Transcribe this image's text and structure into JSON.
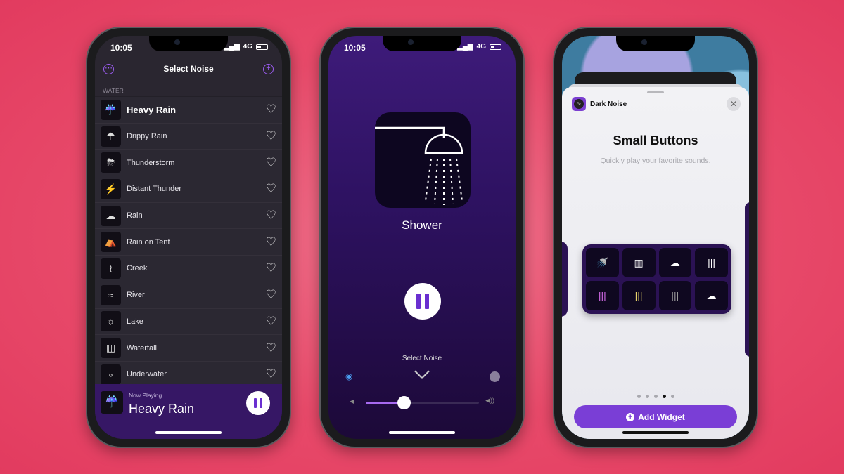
{
  "status": {
    "time": "10:05",
    "network": "4G"
  },
  "list_screen": {
    "title": "Select Noise",
    "section": "WATER",
    "items": [
      {
        "label": "Heavy Rain",
        "icon": "heavy-rain-icon",
        "glyph": "☔",
        "selected": true
      },
      {
        "label": "Drippy Rain",
        "icon": "drippy-rain-icon",
        "glyph": "☂"
      },
      {
        "label": "Thunderstorm",
        "icon": "thunderstorm-icon",
        "glyph": "⛈"
      },
      {
        "label": "Distant Thunder",
        "icon": "distant-thunder-icon",
        "glyph": "⚡"
      },
      {
        "label": "Rain",
        "icon": "rain-icon",
        "glyph": "☁"
      },
      {
        "label": "Rain on Tent",
        "icon": "tent-icon",
        "glyph": "⛺"
      },
      {
        "label": "Creek",
        "icon": "creek-icon",
        "glyph": "≀"
      },
      {
        "label": "River",
        "icon": "river-icon",
        "glyph": "≈"
      },
      {
        "label": "Lake",
        "icon": "lake-icon",
        "glyph": "☼"
      },
      {
        "label": "Waterfall",
        "icon": "waterfall-icon",
        "glyph": "▥"
      },
      {
        "label": "Underwater",
        "icon": "bubbles-icon",
        "glyph": "∘"
      }
    ],
    "heart": "♡",
    "now_playing": {
      "caption": "Now Playing",
      "title": "Heavy Rain"
    }
  },
  "player_screen": {
    "sound": "Shower",
    "select_label": "Select Noise",
    "volume": 0.33
  },
  "widget_screen": {
    "app_name": "Dark Noise",
    "title": "Small Buttons",
    "subtitle": "Quickly play your favorite sounds.",
    "add_label": "Add Widget",
    "page_count": 5,
    "active_page": 4,
    "buttons": [
      {
        "glyph": "🚿",
        "color": "#ffffff"
      },
      {
        "glyph": "▥",
        "color": "#ffffff"
      },
      {
        "glyph": "☁",
        "color": "#ffffff"
      },
      {
        "glyph": "|||",
        "color": "#ffffff"
      },
      {
        "glyph": "|||",
        "color": "#d36ae8"
      },
      {
        "glyph": "|||",
        "color": "#e8d36a"
      },
      {
        "glyph": "|||",
        "color": "#9a9a9a"
      },
      {
        "glyph": "☁",
        "color": "#ffffff"
      }
    ]
  },
  "colors": {
    "accent": "#9b5cf0",
    "now_playing_bg": "#361765",
    "add_widget": "#7a3ed6"
  }
}
